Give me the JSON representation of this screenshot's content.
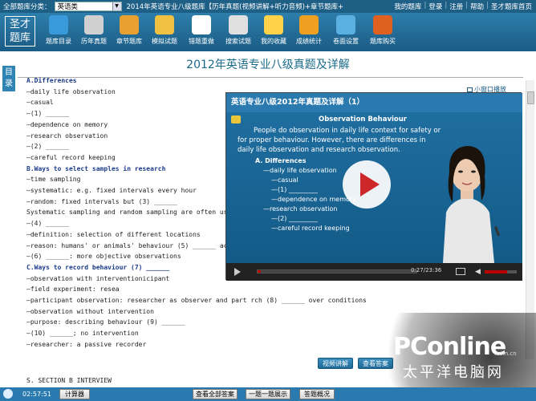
{
  "topbar": {
    "category_label": "全部题库分类：",
    "category_value": "英语类",
    "title": "2014年英语专业八级题库【历年真题(视频讲解+听力音频)+章节题库+",
    "links": [
      "我的题库",
      "登录",
      "注册",
      "帮助",
      "圣才题库首页"
    ]
  },
  "toolbar": {
    "logo": "圣才题库",
    "items": [
      {
        "label": "题库目录",
        "icon": "catalog-icon",
        "color": "#3a9ad9"
      },
      {
        "label": "历年真题",
        "icon": "exam-papers-icon",
        "color": "#d0d0d0"
      },
      {
        "label": "章节题库",
        "icon": "chapter-icon",
        "color": "#e8a030"
      },
      {
        "label": "模拟试题",
        "icon": "mock-test-icon",
        "color": "#f0c040"
      },
      {
        "label": "错题重做",
        "icon": "redo-icon",
        "color": "#ffffff"
      },
      {
        "label": "搜索试题",
        "icon": "search-icon",
        "color": "#e0e0e0"
      },
      {
        "label": "我的收藏",
        "icon": "star-icon",
        "color": "#ffd24a"
      },
      {
        "label": "成绩统计",
        "icon": "stats-icon",
        "color": "#f0a020"
      },
      {
        "label": "卷面设置",
        "icon": "settings-icon",
        "color": "#5ab0e0"
      },
      {
        "label": "题库购买",
        "icon": "cart-icon",
        "color": "#e06020"
      }
    ]
  },
  "page_title": "2012年英语专业八级真题及详解",
  "side_tab": "目录",
  "content_lines": [
    {
      "text": "A.Differences",
      "bold": true
    },
    {
      "text": "—daily life observation",
      "bold": false
    },
    {
      "text": "—casual",
      "bold": false
    },
    {
      "text": "—(1) ______",
      "bold": false
    },
    {
      "text": "—dependence on memory",
      "bold": false
    },
    {
      "text": "—research observation",
      "bold": false
    },
    {
      "text": "—(2) ______",
      "bold": false
    },
    {
      "text": "—careful record keeping",
      "bold": false
    },
    {
      "text": "B.Ways to select samples in research",
      "bold": true
    },
    {
      "text": "—time sampling",
      "bold": false
    },
    {
      "text": "—systematic: e.g. fixed intervals every hour",
      "bold": false
    },
    {
      "text": "—random: fixed intervals but (3) ______",
      "bold": false
    },
    {
      "text": "Systematic sampling and random sampling are often used",
      "bold": false
    },
    {
      "text": "—(4) ______",
      "bold": false
    },
    {
      "text": "—definition: selection of different locations",
      "bold": false
    },
    {
      "text": "—reason: humans' or animals' behaviour (5) ______ acr",
      "bold": false
    },
    {
      "text": "—(6) ______: more objective observations",
      "bold": false
    },
    {
      "text": "C.Ways to record behaviour (7) ______",
      "bold": true
    },
    {
      "text": "—observation with interventionicipant",
      "bold": false
    },
    {
      "text": "—field experiment: resea",
      "bold": false
    },
    {
      "text": "—participant observation: researcher as observer and part rch (8) ______ over conditions",
      "bold": false
    },
    {
      "text": "—observation without intervention",
      "bold": false
    },
    {
      "text": "—purpose: describing behaviour (9) ______",
      "bold": false
    },
    {
      "text": "—(10) ______; no intervention",
      "bold": false
    },
    {
      "text": "—researcher: a passive recorder",
      "bold": false
    }
  ],
  "video": {
    "small_window_label": "小窗口播放",
    "title": "英语专业八级2012年真题及详解（1）",
    "slide_heading": "Observation Behaviour",
    "slide_paragraph": [
      "People do observation in daily life context for safety or",
      "for proper behaviour. However, there are differences in",
      "daily life observation and research observation."
    ],
    "slide_bullets": [
      "A. Differences",
      "—daily life observation",
      "—casual",
      "—(1) _________",
      "—dependence on memory",
      "—research observation",
      "—(2) _________",
      "—careful record keeping"
    ],
    "time": "0:27/23:36",
    "progress": 0.02
  },
  "action_buttons": {
    "video_explain": "视频讲解",
    "view_answer": "查看答案"
  },
  "section_line": "S. SECTION B INTERVIEW",
  "statusbar": {
    "time": "02:57:51",
    "calculator": "计算器",
    "show_all_answers": "查看全部答案",
    "one_per_page": "一题一题展示",
    "answer_summary": "答题概况"
  },
  "watermark": {
    "brand": "PConline",
    "domain": ".com.cn",
    "cn": "太平洋电脑网"
  }
}
